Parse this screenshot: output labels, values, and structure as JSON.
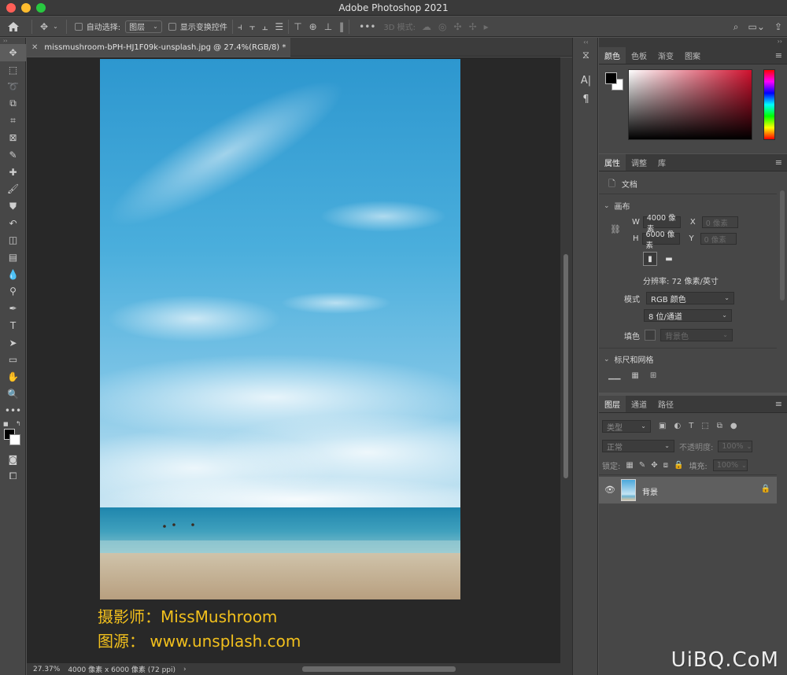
{
  "app": {
    "title": "Adobe Photoshop 2021"
  },
  "options_bar": {
    "auto_select_label": "自动选择:",
    "auto_select_value": "图层",
    "show_transform_label": "显示变换控件",
    "mode_3d_label": "3D 模式:"
  },
  "document": {
    "tab_title": "missmushroom-bPH-HJ1F09k-unsplash.jpg @ 27.4%(RGB/8) *",
    "caption_photographer": "摄影师：MissMushroom",
    "caption_source": "图源：  www.unsplash.com"
  },
  "status": {
    "zoom": "27.37%",
    "doc_info": "4000 像素 x 6000 像素 (72 ppi)"
  },
  "color_panel": {
    "tabs": [
      "颜色",
      "色板",
      "渐变",
      "图案"
    ],
    "foreground": "#000000",
    "background": "#ffffff"
  },
  "properties_panel": {
    "tabs": [
      "属性",
      "调整",
      "库"
    ],
    "doc_label": "文档",
    "canvas_section": "画布",
    "width_label": "W",
    "width_value": "4000 像素",
    "height_label": "H",
    "height_value": "6000 像素",
    "x_label": "X",
    "x_placeholder": "0 像素",
    "y_label": "Y",
    "y_placeholder": "0 像素",
    "resolution": "分辨率: 72 像素/英寸",
    "mode_label": "模式",
    "mode_value": "RGB 颜色",
    "bit_depth": "8 位/通道",
    "fill_label": "填色",
    "fill_value": "背景色",
    "rulers_section": "标尺和网格"
  },
  "layers_panel": {
    "tabs": [
      "图层",
      "通道",
      "路径"
    ],
    "filter_type": "类型",
    "blend_mode": "正常",
    "opacity_label": "不透明度:",
    "opacity_value": "100%",
    "lock_label": "锁定:",
    "fill_label": "填充:",
    "fill_value": "100%",
    "layers": [
      {
        "name": "背景",
        "visible": true,
        "locked": true
      }
    ]
  },
  "watermark": "UiBQ.CoM",
  "colors": {
    "accent_caption": "#f2c01d",
    "ui_dark": "#474747",
    "canvas_bg": "#282828"
  }
}
